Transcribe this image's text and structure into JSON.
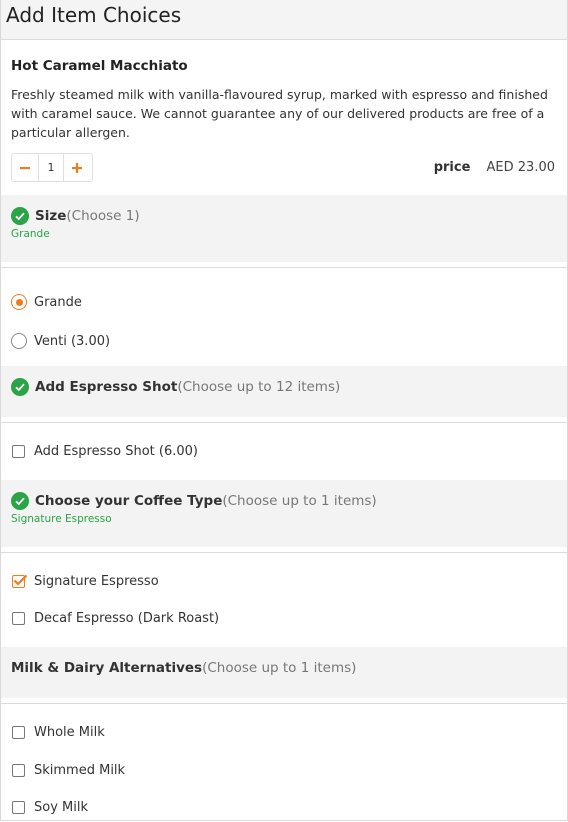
{
  "header": {
    "title": "Add Item Choices"
  },
  "item": {
    "name": "Hot Caramel Macchiato",
    "description": "Freshly steamed milk with vanilla-flavoured syrup, marked with espresso and finished with caramel sauce. We cannot guarantee any of our delivered products are free of a particular allergen.",
    "quantity": "1",
    "minus_icon": "minus-icon",
    "plus_icon": "plus-icon",
    "price_label": "price",
    "price_value": "AED 23.00"
  },
  "groups": [
    {
      "title": "Size",
      "subtitle": "(Choose 1)",
      "selected": "Grande",
      "complete": true,
      "options": [
        {
          "label": "Grande",
          "type": "radio",
          "checked": true
        },
        {
          "label": "Venti (3.00)",
          "type": "radio",
          "checked": false
        }
      ]
    },
    {
      "title": "Add Espresso Shot",
      "subtitle": "(Choose up to 12 items)",
      "selected": "",
      "complete": true,
      "options": [
        {
          "label": "Add Espresso Shot (6.00)",
          "type": "checkbox",
          "checked": false
        }
      ]
    },
    {
      "title": "Choose your Coffee Type",
      "subtitle": "(Choose up to 1 items)",
      "selected": "Signature Espresso",
      "complete": true,
      "options": [
        {
          "label": "Signature Espresso",
          "type": "checkbox",
          "checked": true
        },
        {
          "label": "Decaf Espresso (Dark Roast)",
          "type": "checkbox",
          "checked": false
        }
      ]
    },
    {
      "title": "Milk & Dairy Alternatives",
      "subtitle": "(Choose up to 1 items)",
      "selected": "",
      "complete": false,
      "options": [
        {
          "label": "Whole Milk",
          "type": "checkbox",
          "checked": false
        },
        {
          "label": "Skimmed Milk",
          "type": "checkbox",
          "checked": false
        },
        {
          "label": "Soy Milk",
          "type": "checkbox",
          "checked": false
        }
      ]
    }
  ],
  "colors": {
    "accent": "#f07b1f",
    "success": "#2aa447",
    "panel": "#f3f3f3"
  }
}
